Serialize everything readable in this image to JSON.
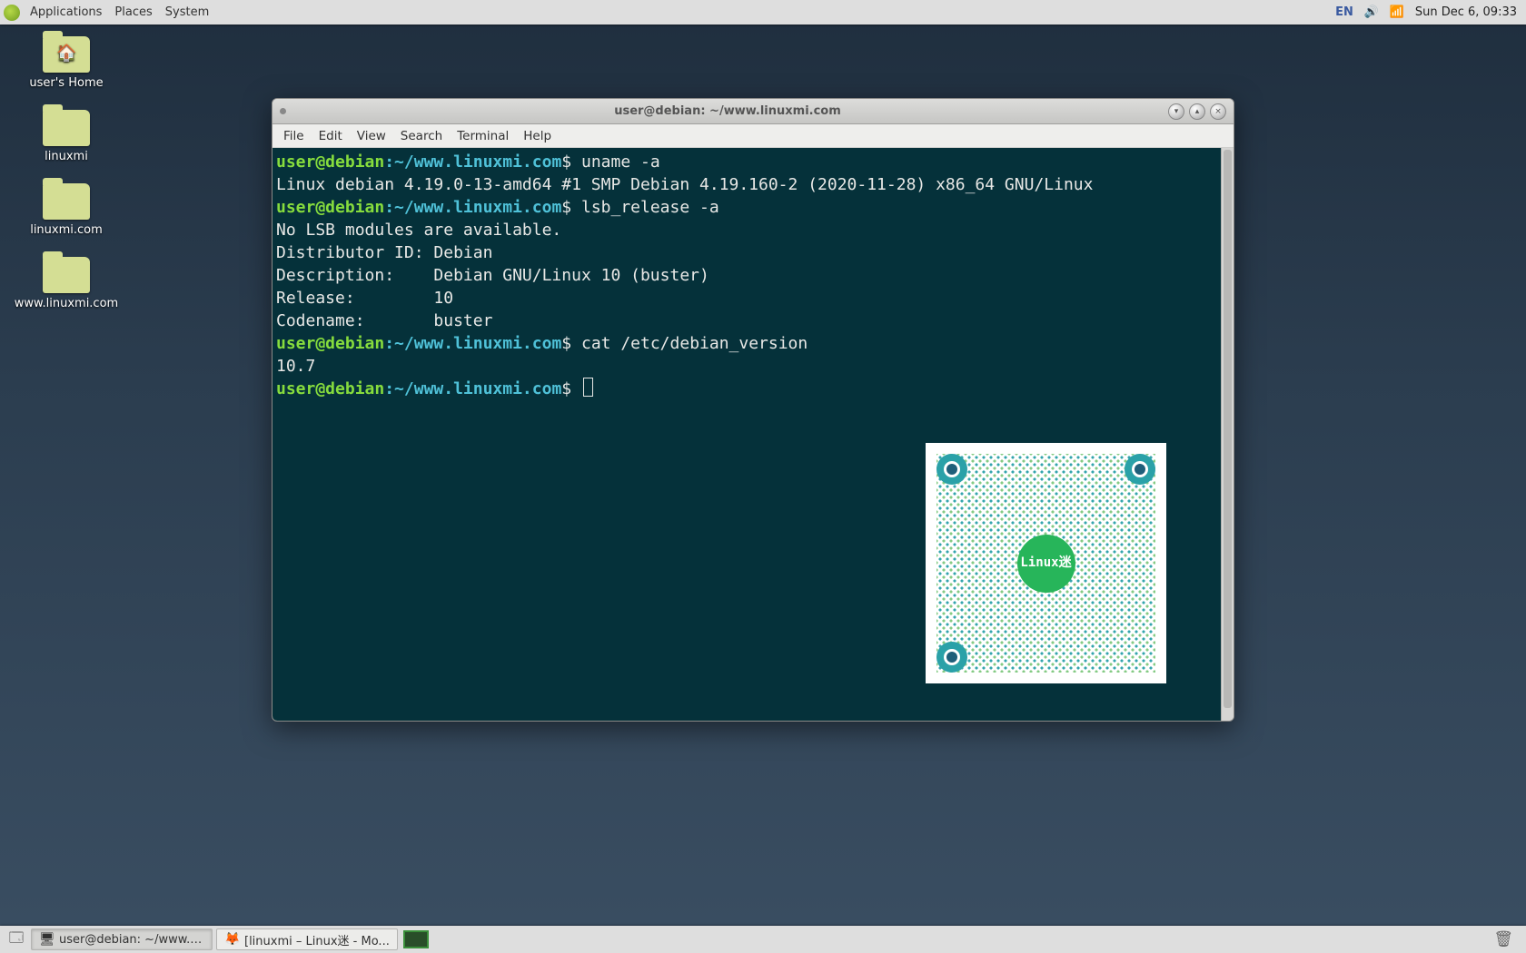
{
  "top_panel": {
    "menus": [
      "Applications",
      "Places",
      "System"
    ],
    "lang": "EN",
    "clock": "Sun Dec  6, 09:33"
  },
  "desktop": {
    "icons": [
      {
        "label": "user's Home",
        "type": "home"
      },
      {
        "label": "linuxmi",
        "type": "folder"
      },
      {
        "label": "linuxmi.com",
        "type": "folder"
      },
      {
        "label": "www.linuxmi.com",
        "type": "folder"
      }
    ]
  },
  "window": {
    "title": "user@debian: ~/www.linuxmi.com",
    "menubar": [
      "File",
      "Edit",
      "View",
      "Search",
      "Terminal",
      "Help"
    ]
  },
  "terminal": {
    "prompt_user": "user@debian",
    "prompt_path": "~/www.linuxmi.com",
    "prompt_symbol": "$",
    "lines": [
      {
        "type": "cmd",
        "command": "uname -a"
      },
      {
        "type": "out",
        "text": "Linux debian 4.19.0-13-amd64 #1 SMP Debian 4.19.160-2 (2020-11-28) x86_64 GNU/Linux"
      },
      {
        "type": "cmd",
        "command": "lsb_release -a"
      },
      {
        "type": "out",
        "text": "No LSB modules are available."
      },
      {
        "type": "out",
        "text": "Distributor ID: Debian"
      },
      {
        "type": "out",
        "text": "Description:    Debian GNU/Linux 10 (buster)"
      },
      {
        "type": "out",
        "text": "Release:        10"
      },
      {
        "type": "out",
        "text": "Codename:       buster"
      },
      {
        "type": "cmd",
        "command": "cat /etc/debian_version"
      },
      {
        "type": "out",
        "text": "10.7"
      },
      {
        "type": "cmd",
        "command": "",
        "cursor": true
      }
    ]
  },
  "qr": {
    "center_label": "Linux迷"
  },
  "bottom_panel": {
    "tasks": [
      {
        "icon": "🖥",
        "label": "user@debian: ~/www.l...",
        "active": true
      },
      {
        "icon": "🦊",
        "label": "[linuxmi – Linux迷 - Mo...",
        "active": false
      }
    ]
  }
}
